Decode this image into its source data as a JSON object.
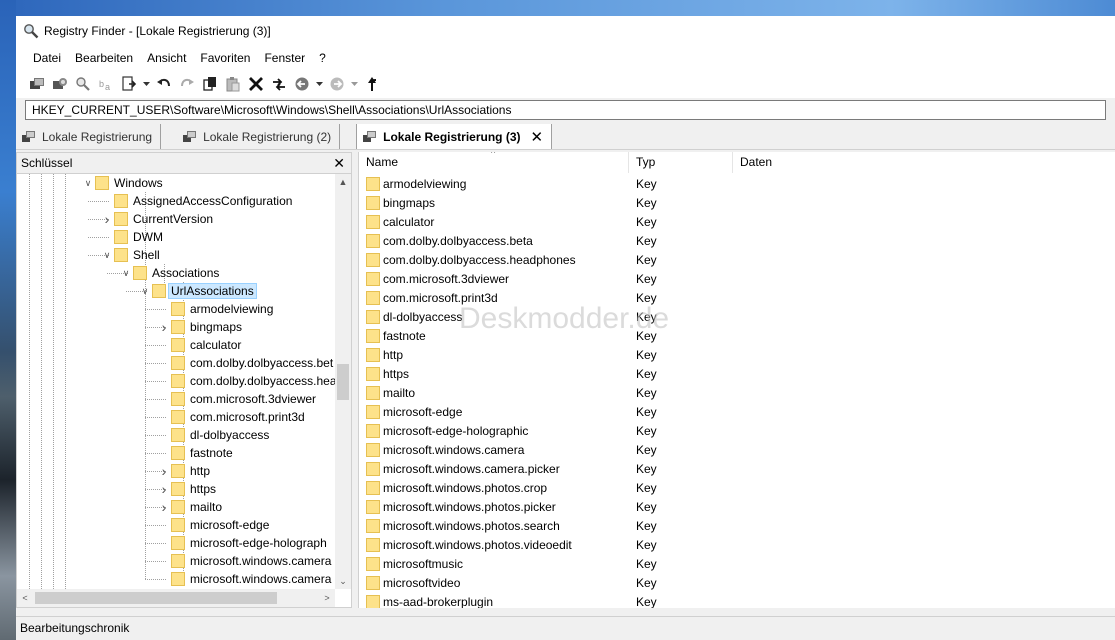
{
  "window": {
    "title": "Registry Finder - [Lokale Registrierung (3)]",
    "app_icon": "magnifier-icon"
  },
  "menu": [
    "Datei",
    "Bearbeiten",
    "Ansicht",
    "Favoriten",
    "Fenster",
    "?"
  ],
  "toolbar": {
    "buttons": [
      "connect-registry-icon",
      "disconnect-registry-icon",
      "find-icon",
      "replace-icon",
      "export-icon",
      "undo-icon",
      "redo-icon",
      "copy-icon",
      "paste-icon",
      "delete-icon",
      "refresh-icon",
      "back-icon",
      "forward-icon",
      "up-icon"
    ]
  },
  "address": {
    "path": "HKEY_CURRENT_USER\\Software\\Microsoft\\Windows\\Shell\\Associations\\UrlAssociations"
  },
  "tabs": [
    {
      "label": "Lokale Registrierung",
      "active": false
    },
    {
      "label": "Lokale Registrierung (2)",
      "active": false
    },
    {
      "label": "Lokale Registrierung (3)",
      "active": true
    }
  ],
  "tree": {
    "header": "Schlüssel",
    "nodes": [
      {
        "label": "Windows",
        "level": 0,
        "expander": "expanded"
      },
      {
        "label": "AssignedAccessConfiguration",
        "level": 1,
        "expander": "none"
      },
      {
        "label": "CurrentVersion",
        "level": 1,
        "expander": "collapsed"
      },
      {
        "label": "DWM",
        "level": 1,
        "expander": "none"
      },
      {
        "label": "Shell",
        "level": 1,
        "expander": "expanded"
      },
      {
        "label": "Associations",
        "level": 2,
        "expander": "expanded"
      },
      {
        "label": "UrlAssociations",
        "level": 3,
        "expander": "expanded",
        "selected": true
      },
      {
        "label": "armodelviewing",
        "level": 4,
        "expander": "none"
      },
      {
        "label": "bingmaps",
        "level": 4,
        "expander": "collapsed"
      },
      {
        "label": "calculator",
        "level": 4,
        "expander": "none"
      },
      {
        "label": "com.dolby.dolbyaccess.bet",
        "level": 4,
        "expander": "none"
      },
      {
        "label": "com.dolby.dolbyaccess.hea",
        "level": 4,
        "expander": "none"
      },
      {
        "label": "com.microsoft.3dviewer",
        "level": 4,
        "expander": "none"
      },
      {
        "label": "com.microsoft.print3d",
        "level": 4,
        "expander": "none"
      },
      {
        "label": "dl-dolbyaccess",
        "level": 4,
        "expander": "none"
      },
      {
        "label": "fastnote",
        "level": 4,
        "expander": "none"
      },
      {
        "label": "http",
        "level": 4,
        "expander": "collapsed"
      },
      {
        "label": "https",
        "level": 4,
        "expander": "collapsed"
      },
      {
        "label": "mailto",
        "level": 4,
        "expander": "collapsed"
      },
      {
        "label": "microsoft-edge",
        "level": 4,
        "expander": "none"
      },
      {
        "label": "microsoft-edge-holograph",
        "level": 4,
        "expander": "none"
      },
      {
        "label": "microsoft.windows.camera",
        "level": 4,
        "expander": "none"
      },
      {
        "label": "microsoft.windows.camera",
        "level": 4,
        "expander": "none"
      }
    ]
  },
  "list": {
    "columns": [
      "Name",
      "Typ",
      "Daten"
    ],
    "rows": [
      {
        "name": "armodelviewing",
        "type": "Key"
      },
      {
        "name": "bingmaps",
        "type": "Key"
      },
      {
        "name": "calculator",
        "type": "Key"
      },
      {
        "name": "com.dolby.dolbyaccess.beta",
        "type": "Key"
      },
      {
        "name": "com.dolby.dolbyaccess.headphones",
        "type": "Key"
      },
      {
        "name": "com.microsoft.3dviewer",
        "type": "Key"
      },
      {
        "name": "com.microsoft.print3d",
        "type": "Key"
      },
      {
        "name": "dl-dolbyaccess",
        "type": "Key"
      },
      {
        "name": "fastnote",
        "type": "Key"
      },
      {
        "name": "http",
        "type": "Key"
      },
      {
        "name": "https",
        "type": "Key"
      },
      {
        "name": "mailto",
        "type": "Key"
      },
      {
        "name": "microsoft-edge",
        "type": "Key"
      },
      {
        "name": "microsoft-edge-holographic",
        "type": "Key"
      },
      {
        "name": "microsoft.windows.camera",
        "type": "Key"
      },
      {
        "name": "microsoft.windows.camera.picker",
        "type": "Key"
      },
      {
        "name": "microsoft.windows.photos.crop",
        "type": "Key"
      },
      {
        "name": "microsoft.windows.photos.picker",
        "type": "Key"
      },
      {
        "name": "microsoft.windows.photos.search",
        "type": "Key"
      },
      {
        "name": "microsoft.windows.photos.videoedit",
        "type": "Key"
      },
      {
        "name": "microsoftmusic",
        "type": "Key"
      },
      {
        "name": "microsoftvideo",
        "type": "Key"
      },
      {
        "name": "ms-aad-brokerplugin",
        "type": "Key"
      }
    ]
  },
  "watermark": "Deskmodder.de",
  "status": "Bearbeitungschronik",
  "colors": {
    "folder": "#fde28a",
    "selection": "#cce8ff",
    "accent": "#99d1ff"
  }
}
